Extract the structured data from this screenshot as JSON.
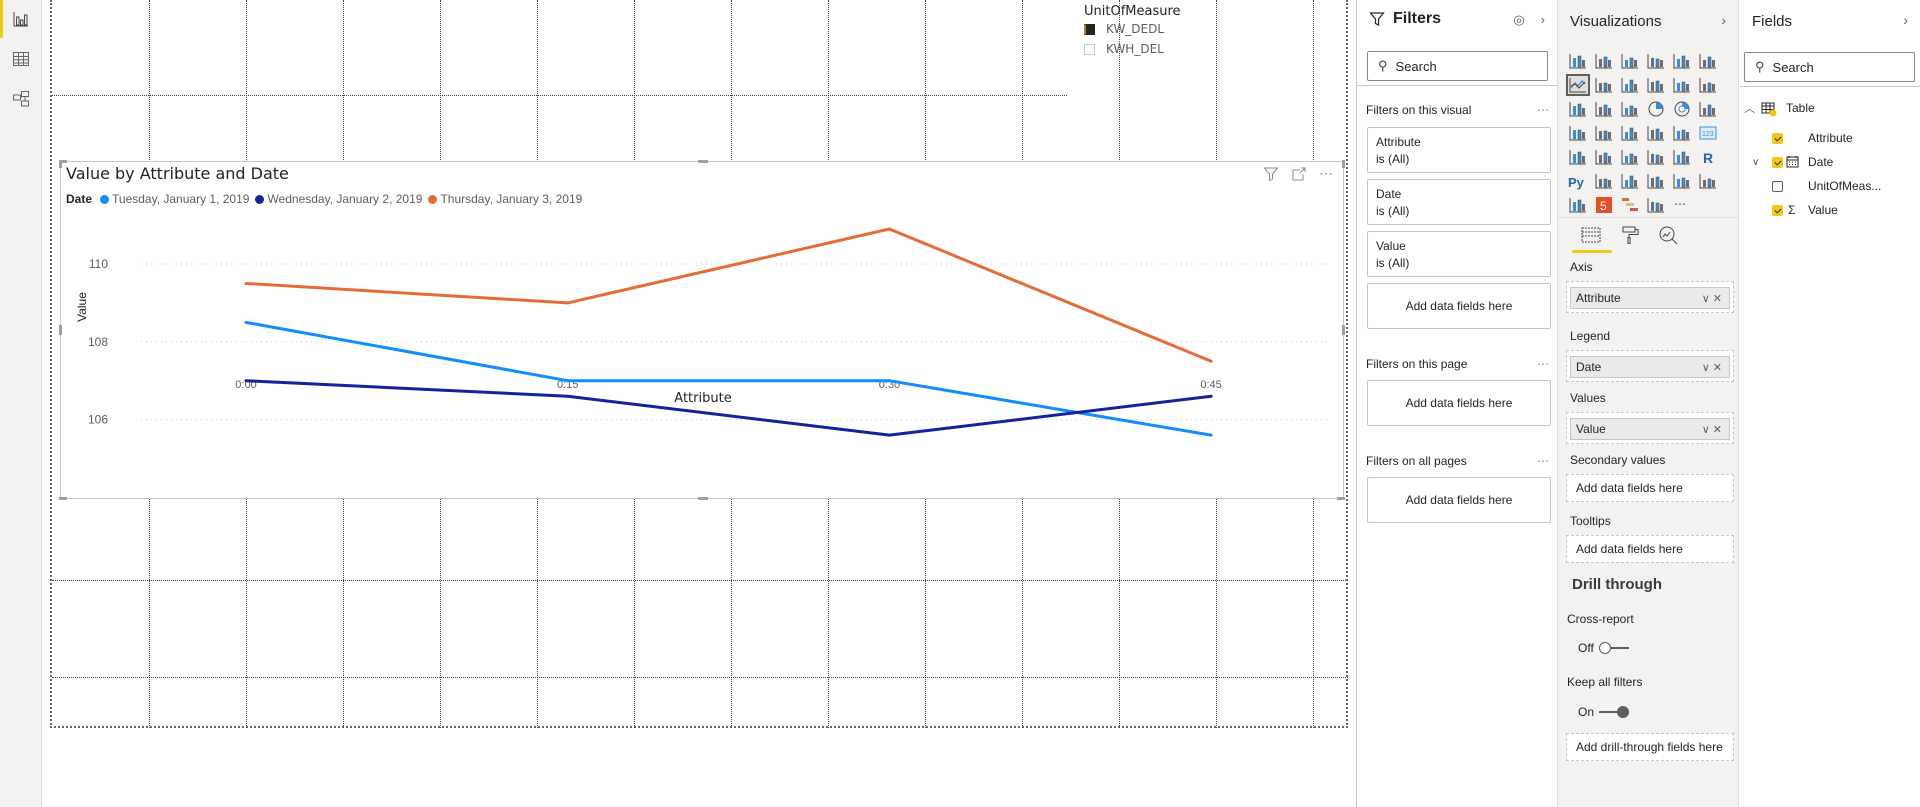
{
  "left_nav": {
    "items": [
      {
        "name": "report-view",
        "icon": "bar-chart-icon",
        "active": true
      },
      {
        "name": "data-view",
        "icon": "table-grid-icon",
        "active": false
      },
      {
        "name": "model-view",
        "icon": "model-icon",
        "active": false
      }
    ]
  },
  "slicer": {
    "title": "UnitOfMeasure",
    "options": [
      {
        "label": "KW_DEDL",
        "checked": true
      },
      {
        "label": "KWH_DEL",
        "checked": false
      }
    ]
  },
  "visual": {
    "title": "Value by Attribute and Date",
    "legend_title": "Date",
    "header_icons": [
      "filter-icon",
      "focus-mode-icon",
      "more-options-icon"
    ],
    "more_label": "⋯"
  },
  "chart_data": {
    "type": "line",
    "title": "Value by Attribute and Date",
    "xlabel": "Attribute",
    "ylabel": "Value",
    "categories": [
      "0:00",
      "0:15",
      "0:30",
      "0:45"
    ],
    "yticks": [
      106,
      108,
      110
    ],
    "ylim": [
      104.6,
      111.9
    ],
    "grid": true,
    "legend_title": "Date",
    "legend_position": "top-left",
    "series": [
      {
        "name": "Tuesday, January 1, 2019",
        "color": "#118DFF",
        "values": [
          108.5,
          107.0,
          107.0,
          105.6
        ]
      },
      {
        "name": "Wednesday, January 2, 2019",
        "color": "#12239E",
        "values": [
          107.0,
          106.6,
          105.6,
          106.6
        ]
      },
      {
        "name": "Thursday, January 3, 2019",
        "color": "#E66C37",
        "values": [
          109.5,
          109.0,
          110.9,
          107.5
        ]
      }
    ]
  },
  "filters": {
    "title": "Filters",
    "search_placeholder": "Search",
    "on_visual_label": "Filters on this visual",
    "cards": [
      {
        "field": "Attribute",
        "state": "is (All)"
      },
      {
        "field": "Date",
        "state": "is (All)"
      },
      {
        "field": "Value",
        "state": "is (All)"
      }
    ],
    "add_fields_label": "Add data fields here",
    "on_page_label": "Filters on this page",
    "on_all_pages_label": "Filters on all pages",
    "more": "⋯"
  },
  "visualizations": {
    "title": "Visualizations",
    "chevron": "›",
    "selected_icon_index": 6,
    "icons": [
      "stacked-bar-icon",
      "stacked-column-icon",
      "clustered-bar-icon",
      "clustered-column-icon",
      "100-stacked-bar-icon",
      "100-stacked-column-icon",
      "line-chart-icon",
      "area-chart-icon",
      "stacked-area-icon",
      "line-clustered-column-icon",
      "line-stacked-column-icon",
      "ribbon-chart-icon",
      "waterfall-icon",
      "funnel-icon",
      "scatter-icon",
      "pie-icon",
      "donut-icon",
      "treemap-icon",
      "map-icon",
      "filled-map-icon",
      "shape-map-icon",
      "azure-map-icon",
      "gauge-icon",
      "card-icon",
      "multi-row-card-icon",
      "kpi-icon",
      "slicer-icon",
      "table-icon",
      "matrix-icon",
      "r-visual-icon",
      "python-visual-icon",
      "key-influencers-icon",
      "decomposition-tree-icon",
      "qa-icon",
      "paginated-report-icon",
      "arcgis-icon",
      "power-apps-icon",
      "html5-icon",
      "gantt-icon",
      "bar-gauge-icon",
      "more-visuals-icon"
    ],
    "tabs": [
      "fields-tab-icon",
      "format-tab-icon",
      "analytics-tab-icon"
    ],
    "wells": [
      {
        "label": "Axis",
        "value": "Attribute"
      },
      {
        "label": "Legend",
        "value": "Date"
      },
      {
        "label": "Values",
        "value": "Value"
      },
      {
        "label": "Secondary values",
        "value": null,
        "placeholder": "Add data fields here"
      },
      {
        "label": "Tooltips",
        "value": null,
        "placeholder": "Add data fields here"
      }
    ],
    "drill_through": {
      "title": "Drill through",
      "cross_report_label": "Cross-report",
      "cross_report_state": "Off",
      "keep_filters_label": "Keep all filters",
      "keep_filters_state": "On",
      "add_label": "Add drill-through fields here"
    }
  },
  "fields": {
    "title": "Fields",
    "chevron": "›",
    "search_placeholder": "Search",
    "table": {
      "name": "Table",
      "items": [
        {
          "name": "Attribute",
          "checked": true,
          "type": ""
        },
        {
          "name": "Date",
          "checked": true,
          "type": "calendar"
        },
        {
          "name": "UnitOfMeas...",
          "checked": false,
          "type": ""
        },
        {
          "name": "Value",
          "checked": true,
          "type": "sum"
        }
      ]
    }
  }
}
